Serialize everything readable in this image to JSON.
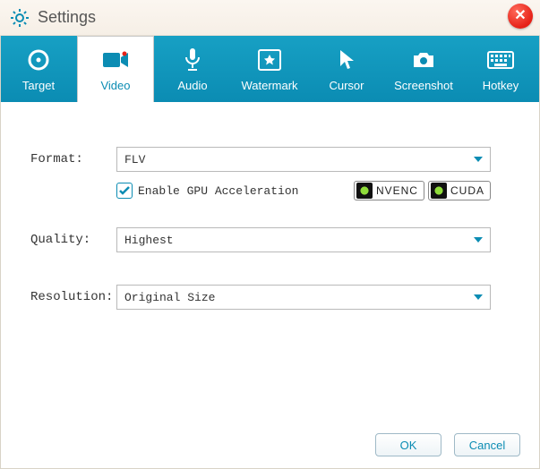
{
  "window": {
    "title": "Settings"
  },
  "tabs": [
    {
      "label": "Target"
    },
    {
      "label": "Video"
    },
    {
      "label": "Audio"
    },
    {
      "label": "Watermark"
    },
    {
      "label": "Cursor"
    },
    {
      "label": "Screenshot"
    },
    {
      "label": "Hotkey"
    }
  ],
  "active_tab": "Video",
  "form": {
    "format_label": "Format:",
    "format_value": "FLV",
    "gpu_checkbox_checked": true,
    "gpu_label": "Enable GPU Acceleration",
    "badge_nvenc": "NVENC",
    "badge_cuda": "CUDA",
    "quality_label": "Quality:",
    "quality_value": "Highest",
    "resolution_label": "Resolution:",
    "resolution_value": "Original Size"
  },
  "footer": {
    "ok": "OK",
    "cancel": "Cancel"
  }
}
